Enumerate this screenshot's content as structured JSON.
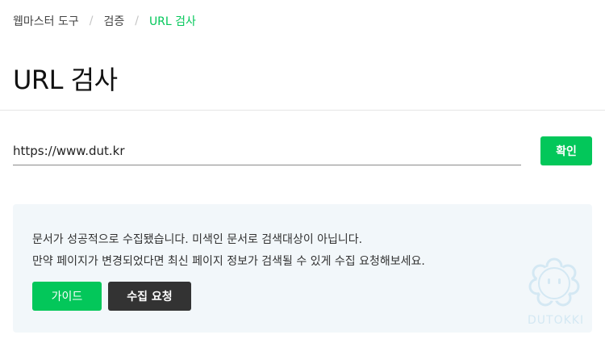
{
  "breadcrumb": {
    "items": [
      "웹마스터 도구",
      "검증",
      "URL 검사"
    ],
    "separator": "/"
  },
  "page": {
    "title": "URL 검사"
  },
  "url_form": {
    "value": "https://www.dut.kr",
    "confirm_label": "확인"
  },
  "notice": {
    "line1": "문서가 성공적으로 수집됐습니다. 미색인 문서로 검색대상이 아닙니다.",
    "line2": "만약 페이지가 변경되었다면 최신 페이지 정보가 검색될 수 있게 수집 요청해보세요.",
    "guide_label": "가이드",
    "request_label": "수집 요청",
    "watermark": "DUTOKKI"
  },
  "colors": {
    "accent": "#03c75a",
    "dark_button": "#333333",
    "notice_bg": "#f2f7fa"
  },
  "icons": {
    "mascot": "cloud-face-icon"
  }
}
